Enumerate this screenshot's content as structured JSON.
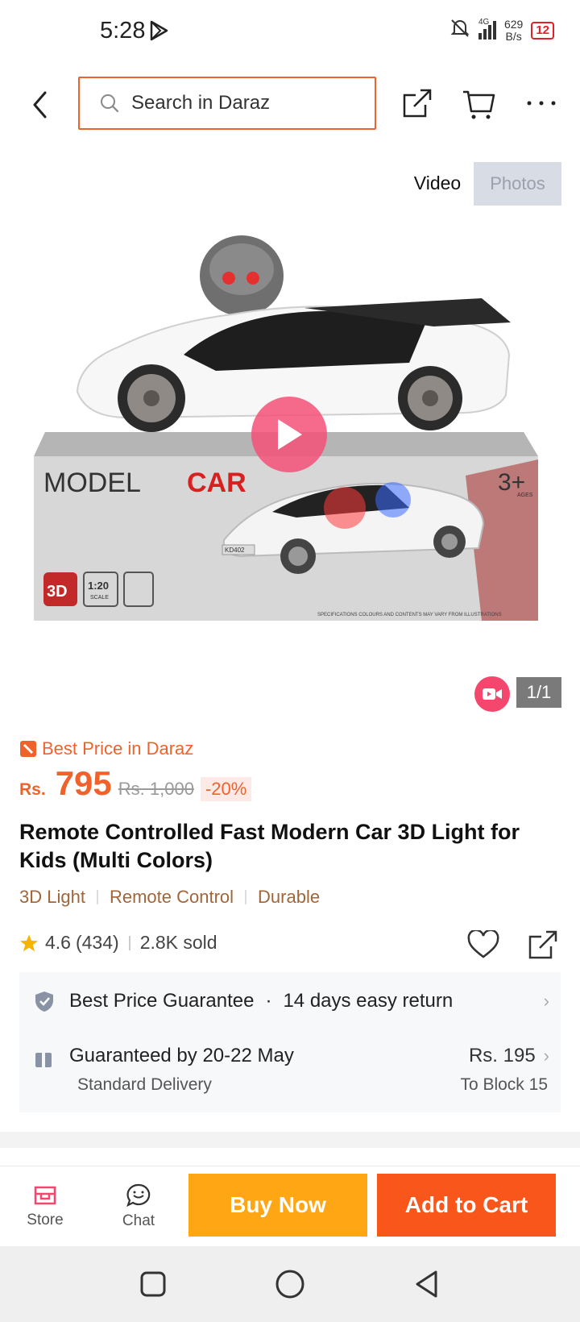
{
  "status_bar": {
    "time": "5:28",
    "net_speed_value": "629",
    "net_speed_unit": "B/s",
    "signal_label": "4G",
    "battery": "12"
  },
  "search": {
    "placeholder": "Search in Daraz"
  },
  "media": {
    "video_tab": "Video",
    "photos_tab": "Photos",
    "counter": "1/1"
  },
  "product": {
    "best_price_label": "Best Price in Daraz",
    "currency": "Rs.",
    "price": "795",
    "old_price": "Rs. 1,000",
    "discount": "-20%",
    "title": "Remote Controlled Fast Modern Car 3D Light for Kids (Multi Colors)",
    "tags": [
      "3D Light",
      "Remote Control",
      "Durable"
    ],
    "rating": "4.6",
    "reviews": "(434)",
    "sold": "2.8K sold"
  },
  "box_art": {
    "brand_left": "MODEL",
    "brand_right": "CAR",
    "age": "3+",
    "age_sub": "AGES",
    "badge_3d": "3D",
    "scale": "1:20",
    "scale_sub": "SCALE",
    "plate": "KD402",
    "fine_print": "SPECIFICATIONS COLOURS AND CONTENTS MAY VARY FROM ILLUSTRATIONS"
  },
  "service": {
    "guarantee": "Best Price Guarantee",
    "dot": "·",
    "returns": "14 days easy return",
    "delivery_title": "Guaranteed by 20-22 May",
    "delivery_type": "Standard Delivery",
    "delivery_fee": "Rs. 195",
    "delivery_location": "To Block 15"
  },
  "bottom_bar": {
    "store": "Store",
    "chat": "Chat",
    "buy_now": "Buy Now",
    "add_to_cart": "Add to Cart"
  },
  "colors": {
    "accent": "#f0622b",
    "buy_now": "#fea613",
    "add_to_cart": "#f8561a",
    "tag_brown": "#a0663a"
  }
}
